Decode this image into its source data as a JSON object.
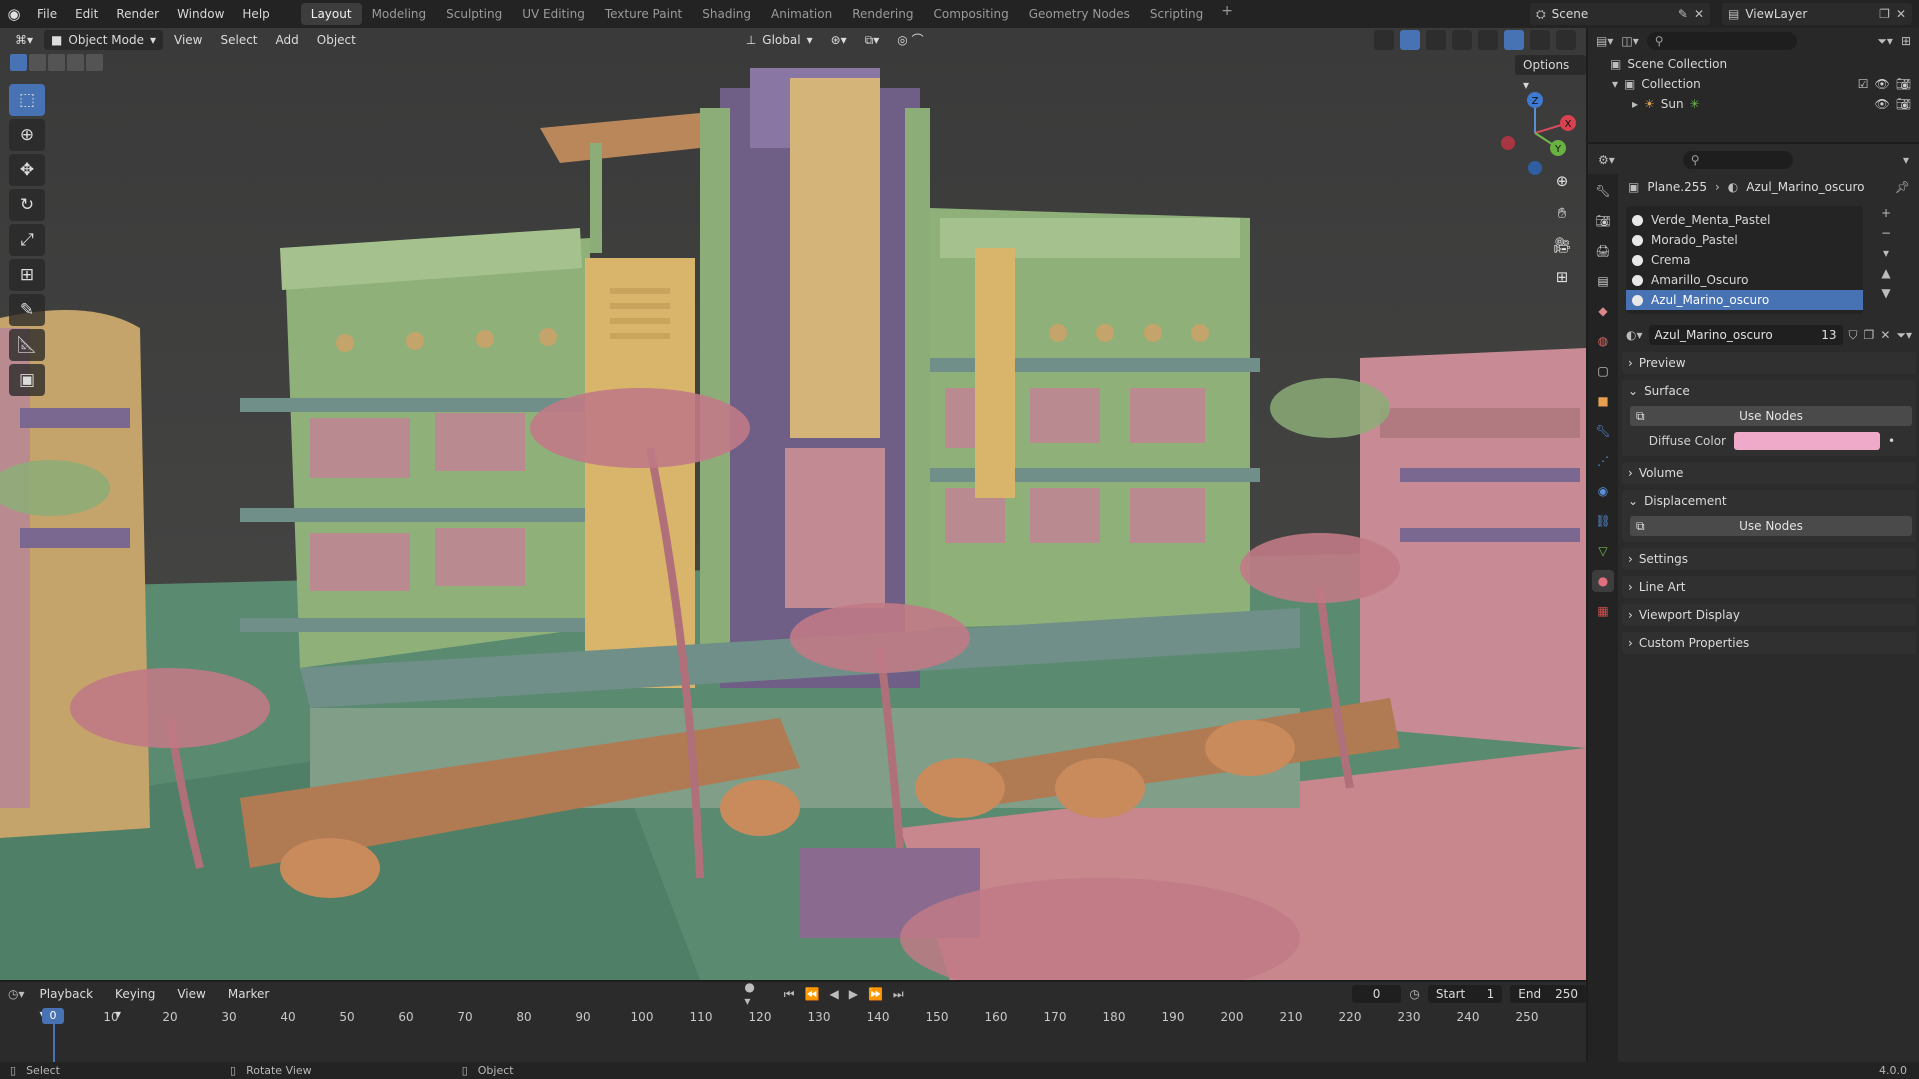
{
  "app": {
    "menus": [
      "File",
      "Edit",
      "Render",
      "Window",
      "Help"
    ],
    "workspaces": [
      "Layout",
      "Modeling",
      "Sculpting",
      "UV Editing",
      "Texture Paint",
      "Shading",
      "Animation",
      "Rendering",
      "Compositing",
      "Geometry Nodes",
      "Scripting"
    ],
    "active_workspace": "Layout",
    "add_tab": "+",
    "scene": "Scene",
    "view_layer": "ViewLayer"
  },
  "viewport": {
    "mode": "Object Mode",
    "menus": [
      "View",
      "Select",
      "Add",
      "Object"
    ],
    "orientation": "Global",
    "options": "Options",
    "gizmo": {
      "x": "X",
      "y": "Y",
      "z": "Z"
    }
  },
  "outliner": {
    "scene_collection": "Scene Collection",
    "collection": "Collection",
    "sun": "Sun"
  },
  "properties": {
    "object": "Plane.255",
    "material": "Azul_Marino_oscuro",
    "slots": [
      "Verde_Menta_Pastel",
      "Morado_Pastel",
      "Crema",
      "Amarillo_Oscuro",
      "Azul_Marino_oscuro"
    ],
    "active_slot": "Azul_Marino_oscuro",
    "material_users": "13",
    "panels": {
      "preview": "Preview",
      "surface": "Surface",
      "use_nodes": "Use Nodes",
      "diffuse_label": "Diffuse Color",
      "volume": "Volume",
      "displacement": "Displacement",
      "use_nodes_2": "Use Nodes",
      "settings": "Settings",
      "line_art": "Line Art",
      "viewport_display": "Viewport Display",
      "custom_properties": "Custom Properties"
    },
    "diffuse_color": "#eeaac8"
  },
  "timeline": {
    "menus": [
      "Playback",
      "Keying",
      "View",
      "Marker"
    ],
    "current_frame": "0",
    "start_label": "Start",
    "start": "1",
    "end_label": "End",
    "end": "250",
    "marker_frame": "0",
    "ticks": [
      "10",
      "20",
      "30",
      "40",
      "50",
      "60",
      "70",
      "80",
      "90",
      "100",
      "110",
      "120",
      "130",
      "140",
      "150",
      "160",
      "170",
      "180",
      "190",
      "200",
      "210",
      "220",
      "230",
      "240",
      "250"
    ]
  },
  "status": {
    "select": "Select",
    "rotate": "Rotate View",
    "object": "Object",
    "version": "4.0.0"
  },
  "colors": {
    "accent": "#4772b3",
    "mint": "#8cad78",
    "purple": "#7a6890",
    "pink": "#c78e9a",
    "cream": "#d2b07a",
    "orange": "#b07a52"
  }
}
